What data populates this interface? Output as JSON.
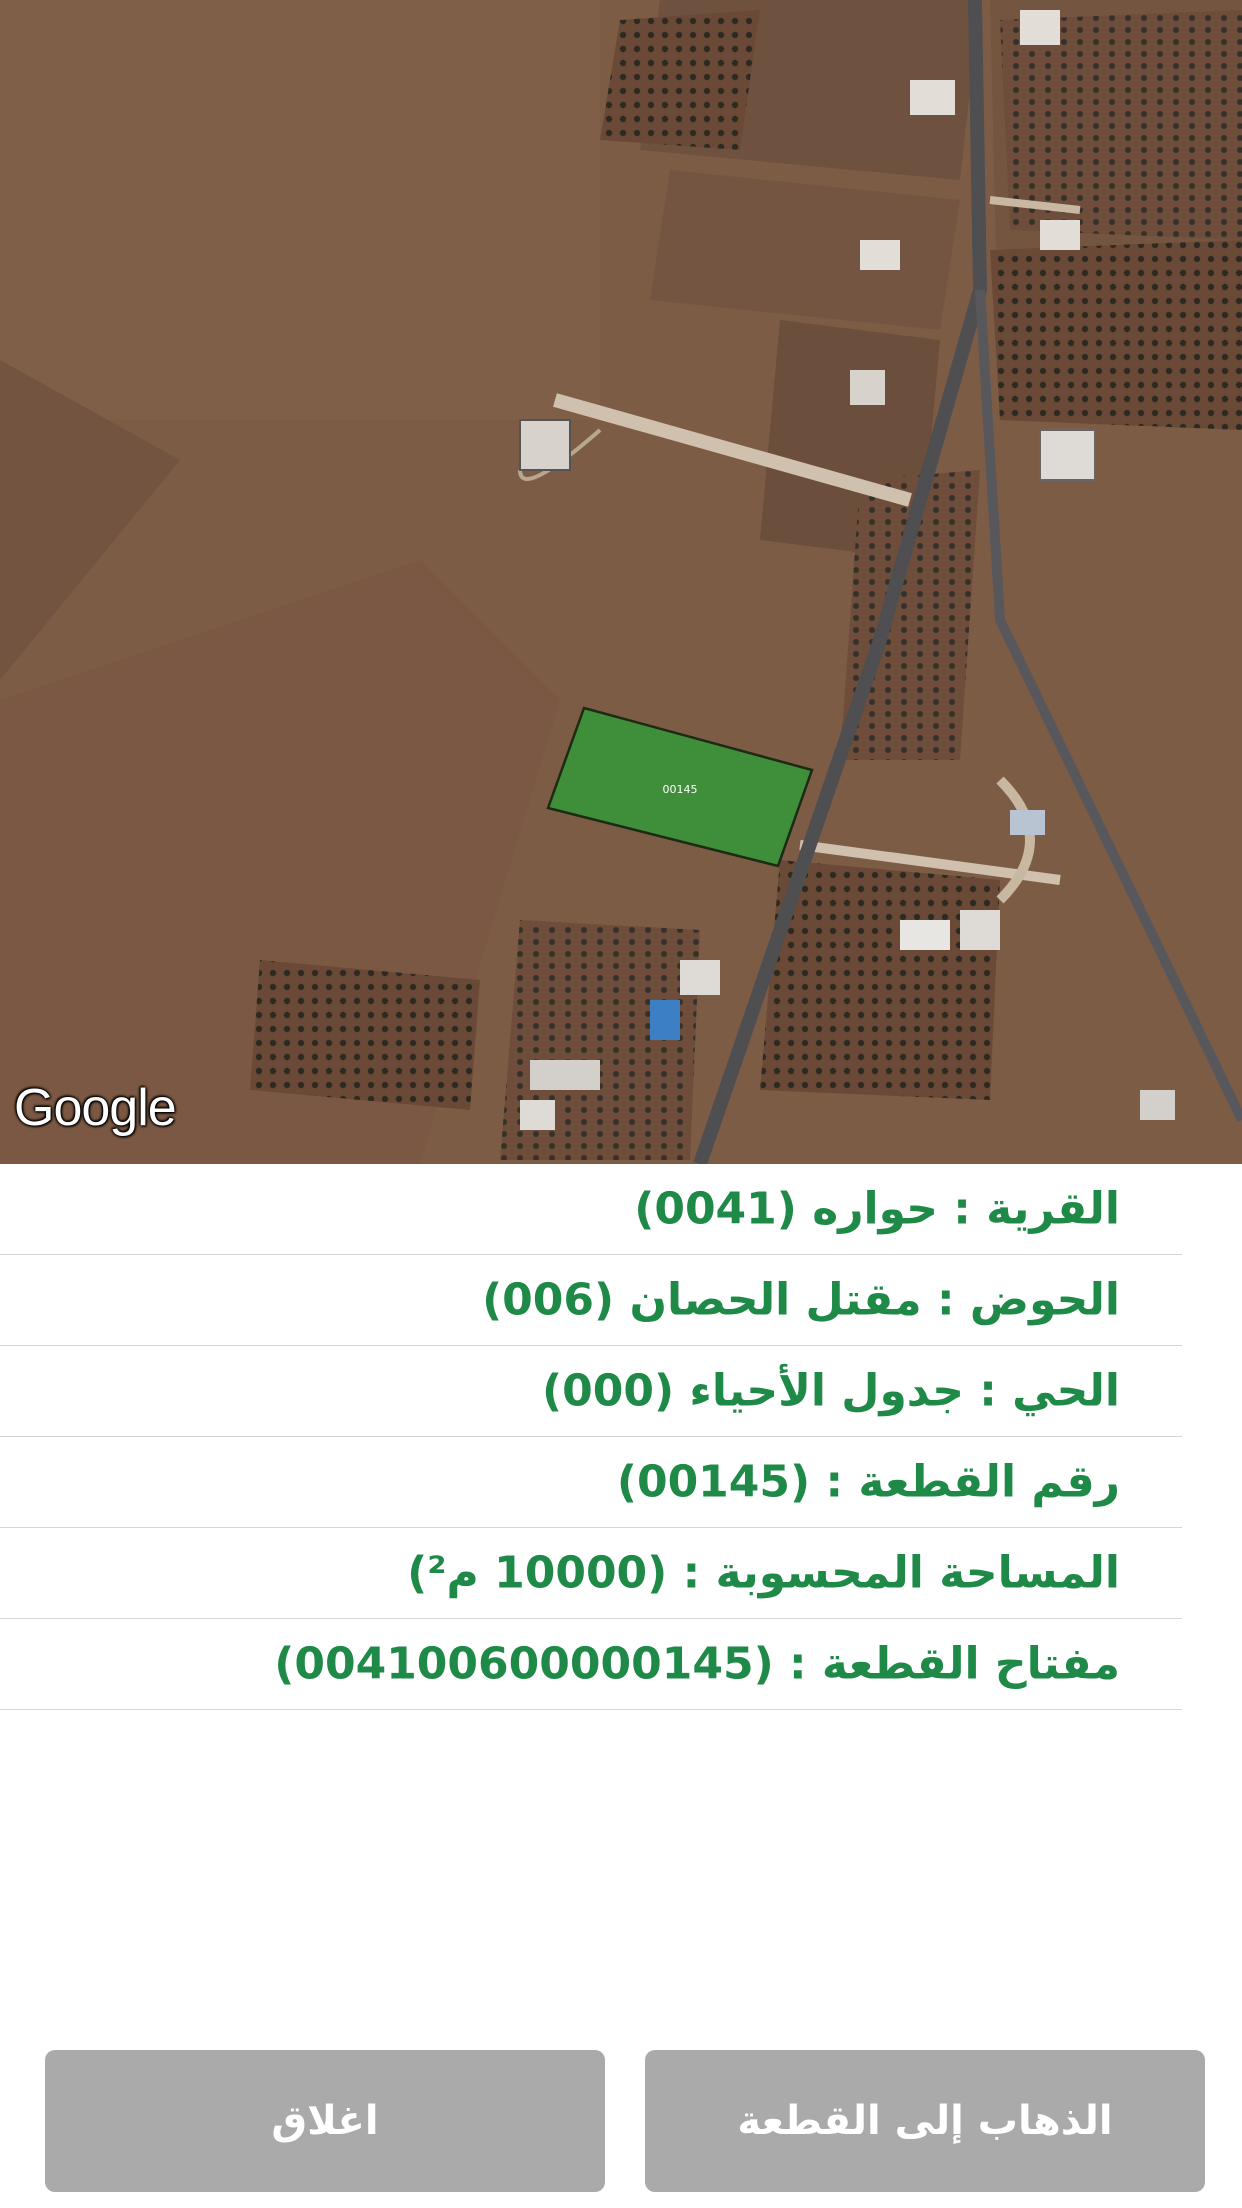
{
  "map": {
    "parcel_label": "00145",
    "logo_text": "Google",
    "colors": {
      "parcel_fill": "#3f8f3a",
      "ground": "#7a5a44"
    }
  },
  "info_rows": [
    {
      "text": "القرية : حواره (0041)"
    },
    {
      "text": "الحوض : مقتل الحصان (006)"
    },
    {
      "text": "الحي : جدول الأحياء (000)"
    },
    {
      "text": "رقم القطعة : (00145)"
    },
    {
      "text": "المساحة المحسوبة : (10000 م²)"
    },
    {
      "text": "مفتاح القطعة : (004100600000145)"
    }
  ],
  "buttons": {
    "close_label": "اغلاق",
    "go_label": "الذهاب إلى القطعة"
  },
  "colors": {
    "info_text": "#1f8a48",
    "button_bg": "#aaaaaa",
    "button_text": "#ffffff"
  }
}
